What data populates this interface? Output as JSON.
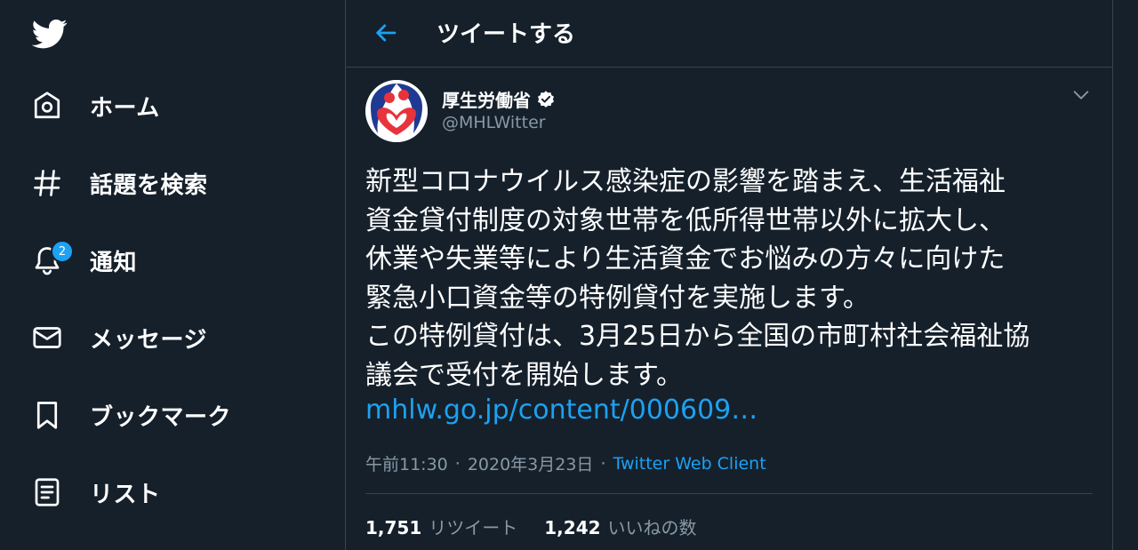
{
  "nav": {
    "items": [
      {
        "label": "ホーム",
        "icon": "home-icon"
      },
      {
        "label": "話題を検索",
        "icon": "hashtag-icon"
      },
      {
        "label": "通知",
        "icon": "bell-icon",
        "badge": "2"
      },
      {
        "label": "メッセージ",
        "icon": "envelope-icon"
      },
      {
        "label": "ブックマーク",
        "icon": "bookmark-icon"
      },
      {
        "label": "リスト",
        "icon": "list-icon"
      }
    ]
  },
  "header": {
    "title": "ツイートする"
  },
  "tweet": {
    "author_name": "厚生労働省",
    "handle": "@MHLWitter",
    "lines": [
      "新型コロナウイルス感染症の影響を踏まえ、生活福祉",
      "資金貸付制度の対象世帯を低所得世帯以外に拡大し、",
      "休業や失業等により生活資金でお悩みの方々に向けた",
      "緊急小口資金等の特例貸付を実施します。",
      "この特例貸付は、3月25日から全国の市町村社会福祉協",
      "議会で受付を開始します。"
    ],
    "link": "mhlw.go.jp/content/000609…",
    "time": "午前11:30",
    "date": "2020年3月23日",
    "separator": "·",
    "client": "Twitter Web Client",
    "retweets_count": "1,751",
    "retweets_label": "リツイート",
    "likes_count": "1,242",
    "likes_label": "いいねの数"
  },
  "colors": {
    "background": "#15202b",
    "accent": "#1da1f2",
    "muted": "#8899a6",
    "border": "#38444d"
  }
}
